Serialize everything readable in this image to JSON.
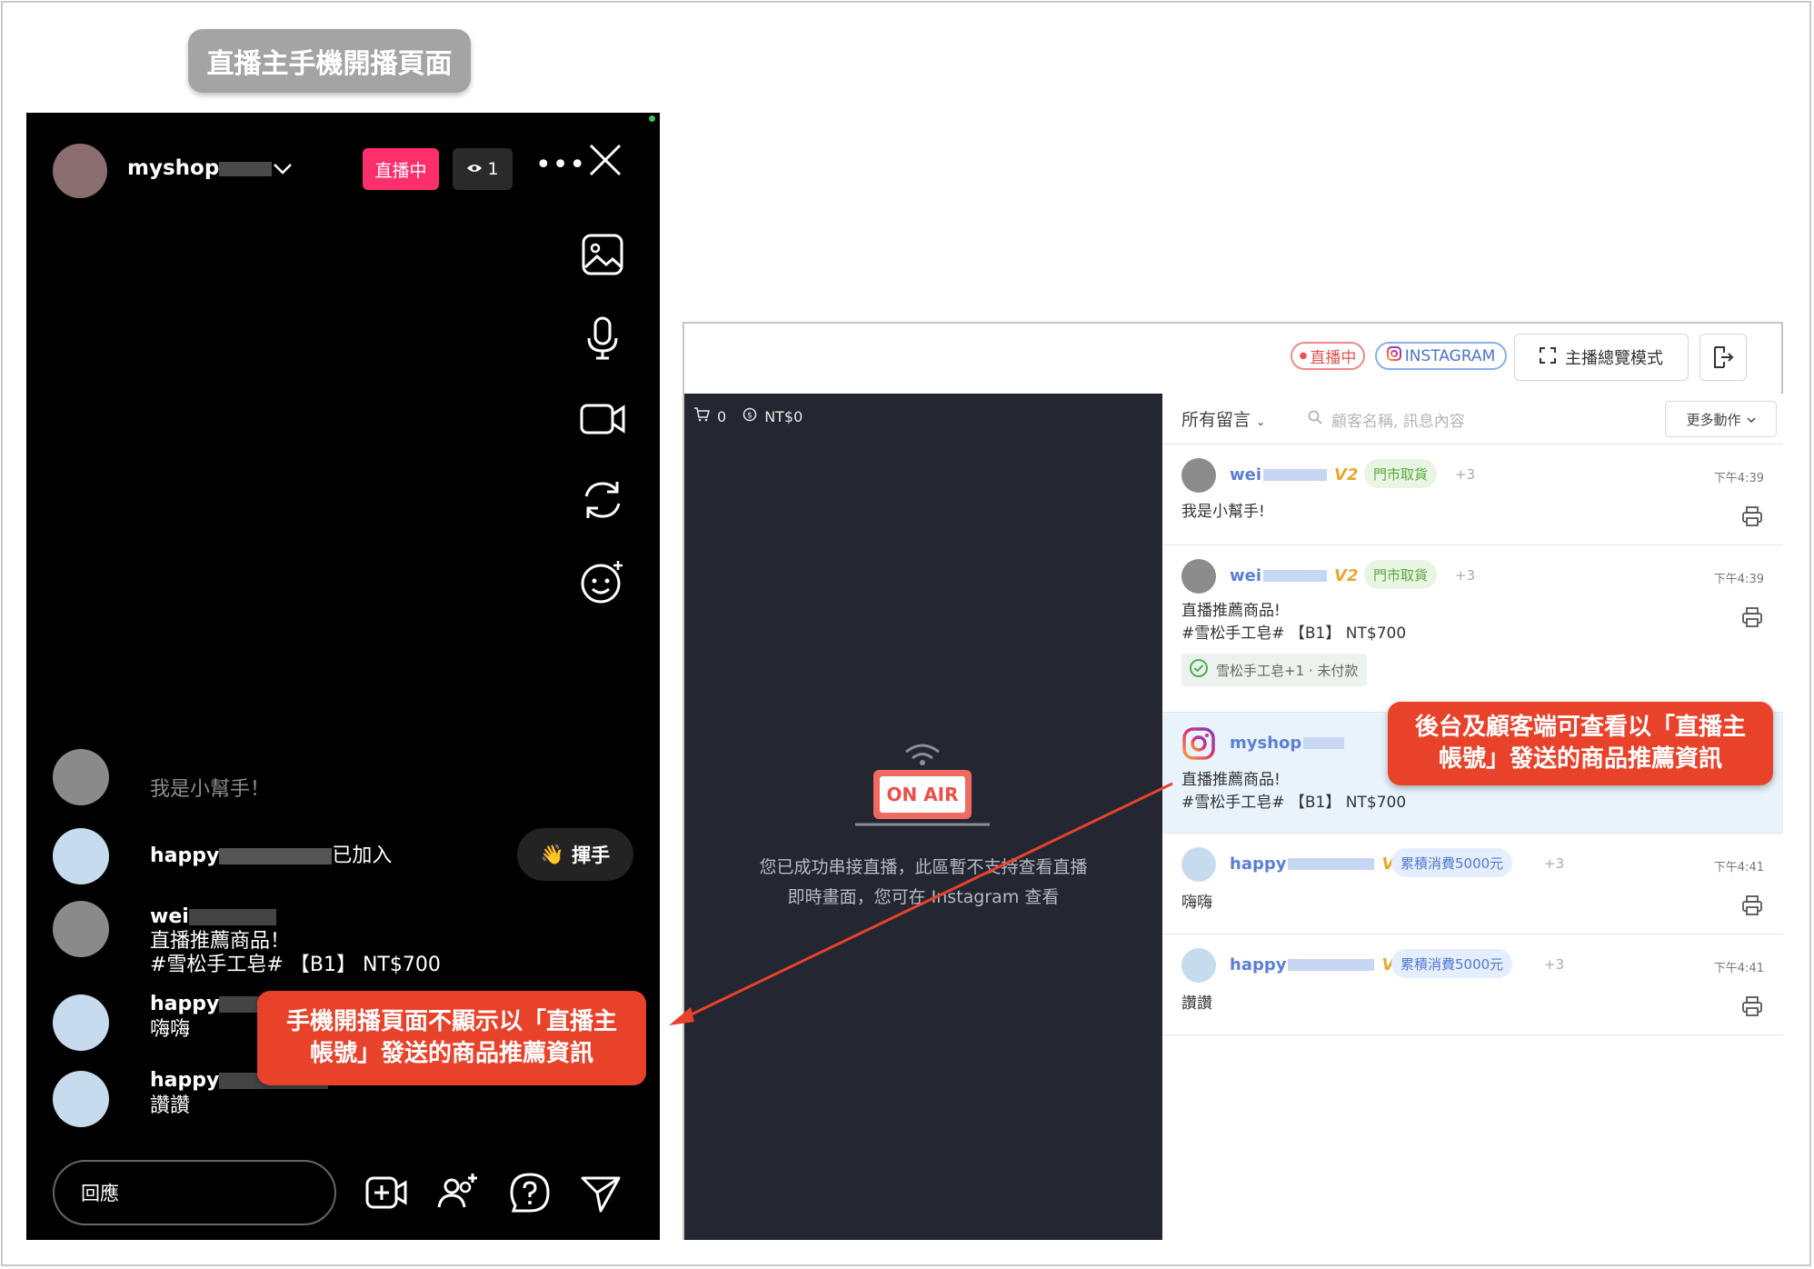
{
  "page_title": "直播主手機開播頁面",
  "phone": {
    "shop_name": "myshop",
    "live_badge": "直播中",
    "viewer_count": "1",
    "comments": [
      {
        "name": "",
        "text": "我是小幫手！"
      },
      {
        "name": "happy",
        "suffix": "已加入"
      },
      {
        "name": "wei",
        "line1": "直播推薦商品！",
        "line2": "#雪松手工皂# 【B1】 NT$700"
      },
      {
        "name": "happy",
        "text": "嗨嗨"
      },
      {
        "name": "happy",
        "text": "讚讚"
      }
    ],
    "wave_label": "揮手",
    "wave_emoji": "👋",
    "reply_placeholder": "回應"
  },
  "callout_left": {
    "line1": "手機開播頁面不顯示以「直播主",
    "line2": "帳號」發送的商品推薦資訊"
  },
  "callout_right": {
    "line1": "後台及顧客端可查看以「直播主",
    "line2": "帳號」發送的商品推薦資訊"
  },
  "backend": {
    "live_pill": "直播中",
    "ig_pill": "INSTAGRAM",
    "preview_button": "主播總覽模式",
    "cart_count": "0",
    "amount": "NT$0",
    "onair_label": "ON AIR",
    "onair_message_line1": "您已成功串接直播，此區暫不支持查看直播",
    "onair_message_line2": "即時畫面，您可在 Instagram 查看",
    "filter_label": "所有留言",
    "search_placeholder": "顧客名稱, 訊息內容",
    "more_actions": "更多動作",
    "comments": [
      {
        "name": "wei",
        "badge": "V2",
        "tag": "門市取貨",
        "more": "+3",
        "time": "下午4:39",
        "body": [
          "我是小幫手!"
        ]
      },
      {
        "name": "wei",
        "badge": "V2",
        "tag": "門市取貨",
        "more": "+3",
        "time": "下午4:39",
        "body": [
          "直播推薦商品!",
          "#雪松手工皂# 【B1】 NT$700"
        ],
        "order_chip": "雪松手工皂+1 · 未付款"
      },
      {
        "name": "myshop",
        "body": [
          "直播推薦商品!",
          "#雪松手工皂# 【B1】 NT$700"
        ]
      },
      {
        "name": "happy",
        "badge": "V2",
        "tag": "累積消費5000元",
        "more": "+3",
        "time": "下午4:41",
        "body": [
          "嗨嗨"
        ]
      },
      {
        "name": "happy",
        "badge": "V2",
        "tag": "累積消費5000元",
        "more": "+3",
        "time": "下午4:41",
        "body": [
          "讚讚"
        ]
      }
    ]
  },
  "colors": {
    "live_red": "#ff2f6e",
    "callout_red": "#e8422b",
    "link_blue": "#5a7fd6",
    "dark_pane": "#242731"
  }
}
